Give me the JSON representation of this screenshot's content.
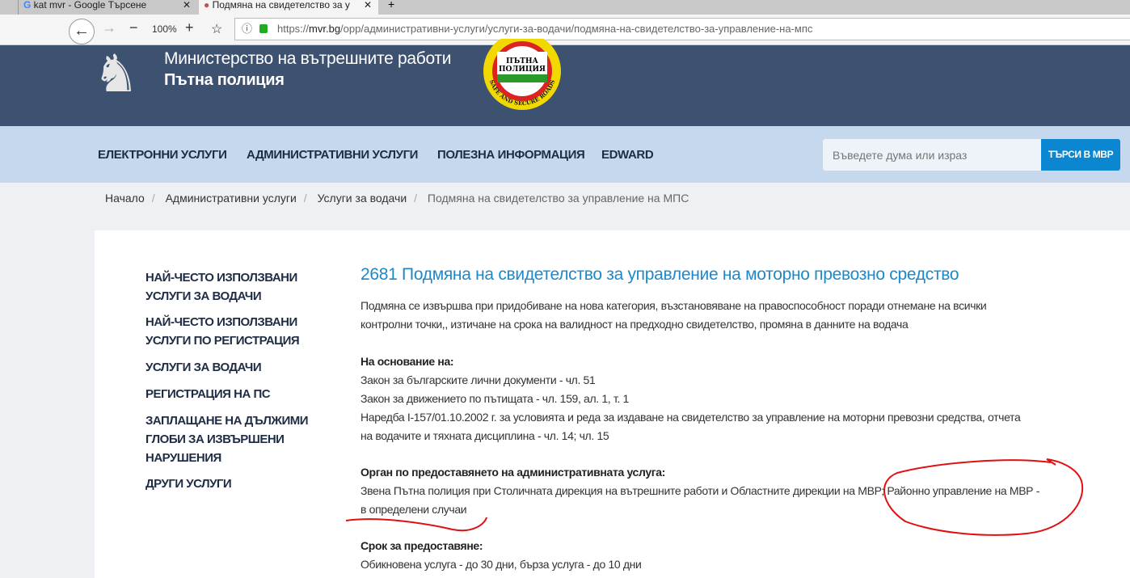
{
  "browser": {
    "tabs": [
      {
        "title": "kat mvr - Google Търсене"
      },
      {
        "title": "Подмяна на свидетелство за у"
      }
    ],
    "zoom": "100%",
    "url_prefix": "https://",
    "url_domain": "mvr.bg",
    "url_path": "/opp/административни-услуги/услуги-за-водачи/подмяна-на-свидетелство-за-управление-на-мпс"
  },
  "header": {
    "ministry": "Министерство на вътрешните работи",
    "department": "Пътна полиция",
    "badge_text": "ПЪТНА ПОЛИЦИЯ",
    "badge_ring": "SAFE AND SECURE ROADS"
  },
  "nav": {
    "items": [
      "ЕЛЕКТРОННИ УСЛУГИ",
      "АДМИНИСТРАТИВНИ УСЛУГИ",
      "ПОЛЕЗНА ИНФОРМАЦИЯ",
      "EDWARD"
    ],
    "search_placeholder": "Въведете дума или израз",
    "search_button": "ТЪРСИ В МВР"
  },
  "breadcrumb": [
    "Начало",
    "Административни услуги",
    "Услуги за водачи",
    "Подмяна на свидетелство за управление на МПС"
  ],
  "sidebar": [
    [
      "НАЙ-ЧЕСТО ИЗПОЛЗВАНИ",
      "УСЛУГИ ЗА ВОДАЧИ"
    ],
    [
      "НАЙ-ЧЕСТО ИЗПОЛЗВАНИ",
      "УСЛУГИ ПО РЕГИСТРАЦИЯ"
    ],
    [
      "УСЛУГИ ЗА ВОДАЧИ"
    ],
    [
      "РЕГИСТРАЦИЯ НА ПС"
    ],
    [
      "ЗАПЛАЩАНЕ НА ДЪЛЖИМИ",
      "ГЛОБИ ЗА ИЗВЪРШЕНИ",
      "НАРУШЕНИЯ"
    ],
    [
      "ДРУГИ УСЛУГИ"
    ]
  ],
  "content": {
    "title": "2681 Подмяна на свидетелство за управление на моторно превозно средство",
    "intro": [
      "Подмяна се извършва при придобиване на нова категория, възстановяване на правоспособност поради отнемане на всички",
      "контролни точки,, изтичане на срока на валидност на предходно свидетелство, промяна в данните на водача"
    ],
    "basis_heading": "На основание на:",
    "basis": [
      "Закон за българските лични документи - чл. 51",
      "Закон за движението по пътищата - чл. 159, ал. 1, т. 1",
      "Наредба I-157/01.10.2002 г. за условията и реда за издаване на свидетелство за управление на моторни превозни средства, отчета",
      "на водачите и тяхната дисциплина - чл. 14; чл. 15"
    ],
    "authority_heading": "Орган по предоставянето на административната услуга:",
    "authority": [
      "Звена Пътна полиция при Столичната дирекция на вътрешните работи и Областните дирекции на МВР; Районно управление на МВР -",
      "в определени случаи"
    ],
    "term_heading": "Срок за предоставяне:",
    "term": "Обикновена услуга - до 30 дни, бърза услуга - до 10 дни"
  },
  "colors": {
    "header": "#3d5170",
    "nav": "#c6d8ee",
    "accent": "#0b86d0",
    "title": "#1e88c8",
    "annotation": "#e01010"
  }
}
